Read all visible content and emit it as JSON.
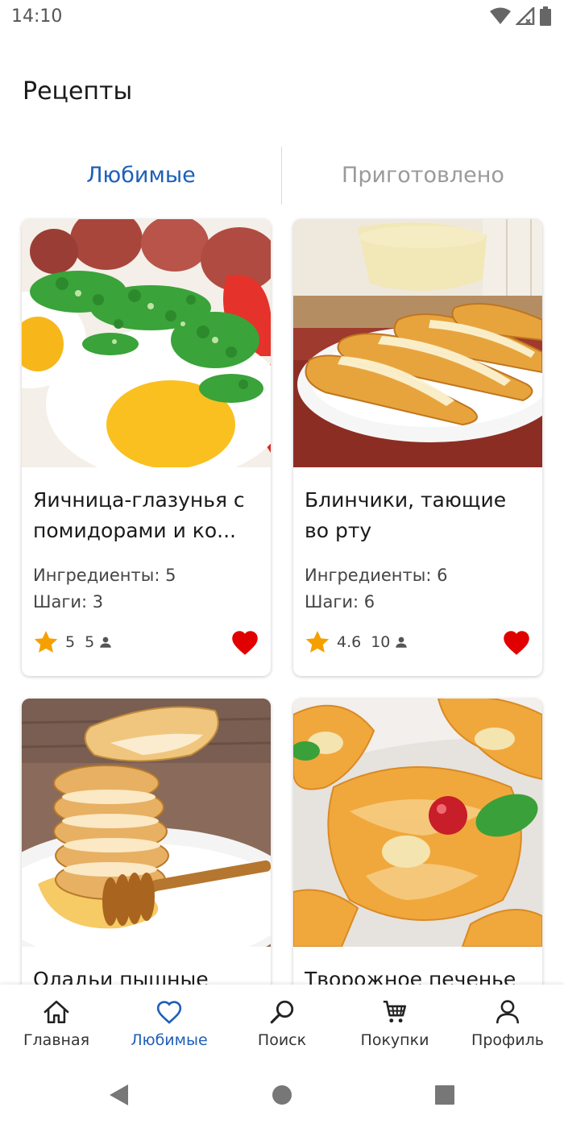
{
  "status": {
    "time": "14:10"
  },
  "page": {
    "title": "Рецепты"
  },
  "tabs": [
    {
      "label": "Любимые",
      "active": true
    },
    {
      "label": "Приготовлено",
      "active": false
    }
  ],
  "recipes": [
    {
      "title": "Яичница-глазунья с помидорами и ко...",
      "ingredients": "Ингредиенты: 5",
      "steps": "Шаги: 3",
      "rating": "5",
      "servings": "5",
      "favorite": true
    },
    {
      "title": "Блинчики, тающие во рту",
      "ingredients": "Ингредиенты: 6",
      "steps": "Шаги: 6",
      "rating": "4.6",
      "servings": "10",
      "favorite": true
    },
    {
      "title": "Оладьи пышные"
    },
    {
      "title": "Творожное печенье"
    }
  ],
  "nav": [
    {
      "label": "Главная",
      "icon": "home-icon"
    },
    {
      "label": "Любимые",
      "icon": "heart-icon",
      "active": true
    },
    {
      "label": "Поиск",
      "icon": "search-icon"
    },
    {
      "label": "Покупки",
      "icon": "cart-icon"
    },
    {
      "label": "Профиль",
      "icon": "profile-icon"
    }
  ],
  "colors": {
    "accent": "#1e5fb8",
    "favorite": "#e00000",
    "star": "#f5a000"
  }
}
